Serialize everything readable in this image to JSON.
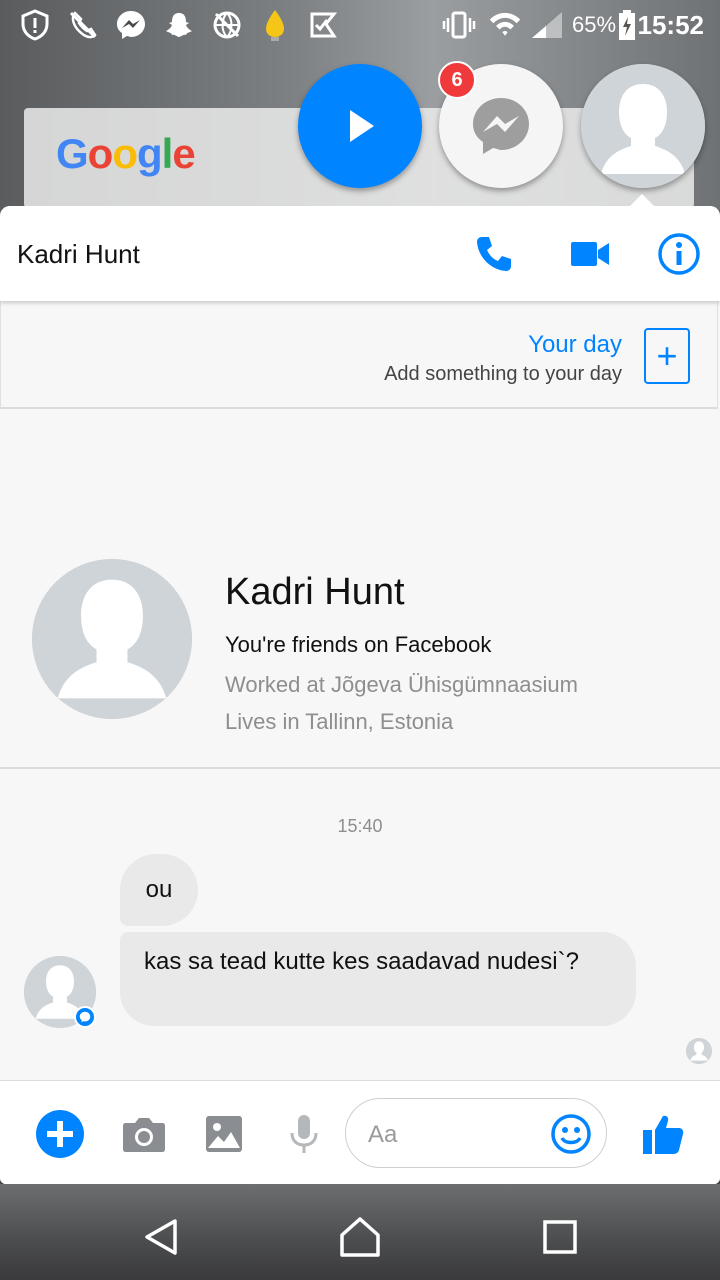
{
  "status_bar": {
    "battery_percent": "65%",
    "time": "15:52",
    "icons": [
      "shield-alert-icon",
      "no-phone-icon",
      "messenger-icon",
      "snapchat-icon",
      "no-network-icon",
      "lightbulb-icon",
      "check-flag-icon",
      "vibrate-icon",
      "wifi-icon",
      "signal-icon",
      "battery-icon"
    ]
  },
  "google_widget": {
    "logo": "Google"
  },
  "chat_heads": {
    "badge_count": "6",
    "items": [
      "play-chathead",
      "messenger-chathead",
      "contact-chathead"
    ]
  },
  "header": {
    "title": "Kadri Hunt",
    "accent_color": "#0084ff"
  },
  "your_day": {
    "title": "Your day",
    "subtitle": "Add something to your day",
    "add_symbol": "+"
  },
  "profile": {
    "name": "Kadri Hunt",
    "friends_text": "You're friends on Facebook",
    "work": "Worked at Jõgeva Ühisgümnaasium",
    "lives": "Lives in Tallinn, Estonia"
  },
  "conversation": {
    "timestamp": "15:40",
    "messages": [
      {
        "text": "ou"
      },
      {
        "text": "kas sa tead kutte kes saadavad nudesi`?"
      }
    ]
  },
  "composer": {
    "placeholder": "Aa"
  }
}
